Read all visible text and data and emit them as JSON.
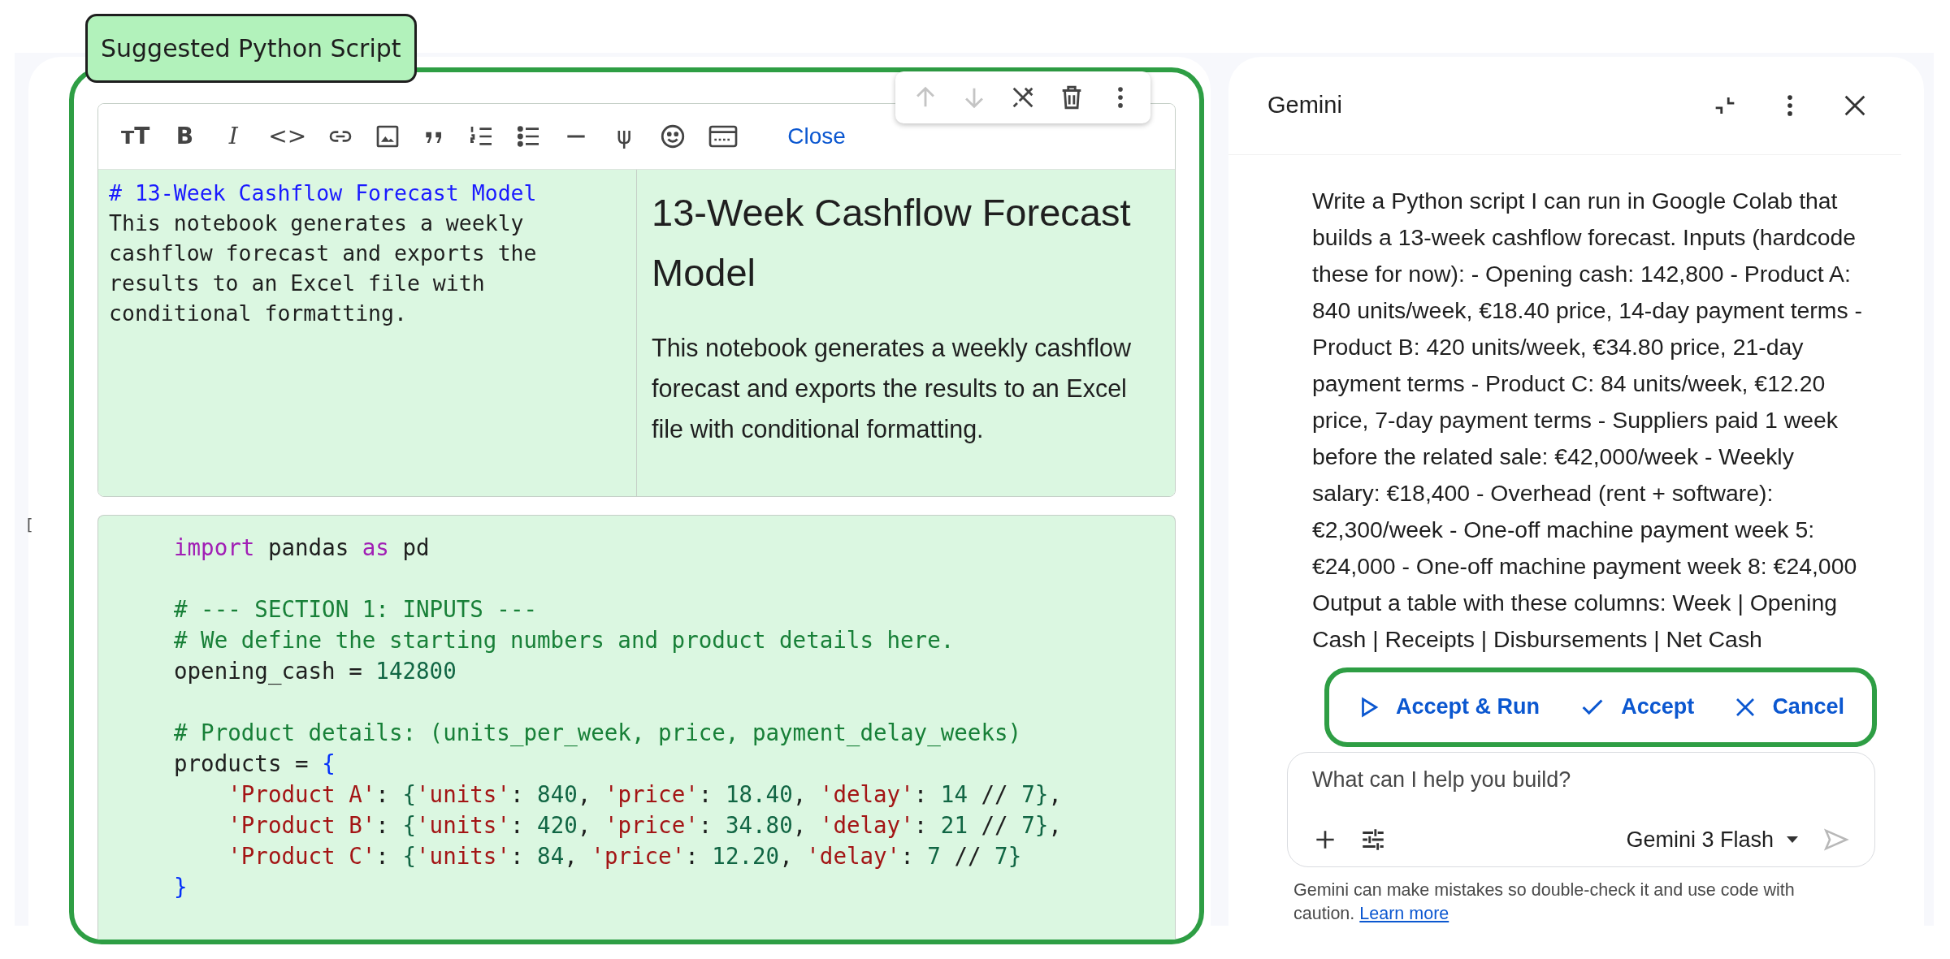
{
  "annotation_label": "Suggested Python Script",
  "cell_toolbar": [
    {
      "kind": "up",
      "disabled": true
    },
    {
      "kind": "down",
      "disabled": true
    },
    {
      "kind": "unlink",
      "disabled": false
    },
    {
      "kind": "delete",
      "disabled": false
    },
    {
      "kind": "more",
      "disabled": false
    }
  ],
  "markdown_toolbar": {
    "items": [
      {
        "kind": "text-size",
        "glyph": "ᴛT"
      },
      {
        "kind": "bold",
        "glyph": "B"
      },
      {
        "kind": "italic",
        "glyph": "I"
      },
      {
        "kind": "code",
        "glyph": "<>"
      },
      {
        "kind": "link"
      },
      {
        "kind": "image"
      },
      {
        "kind": "quote"
      },
      {
        "kind": "numbered-list"
      },
      {
        "kind": "bulleted-list"
      },
      {
        "kind": "rule"
      },
      {
        "kind": "psi",
        "glyph": "ψ"
      },
      {
        "kind": "smiley"
      },
      {
        "kind": "window"
      }
    ],
    "close": "Close"
  },
  "markdown_cell": {
    "source_heading": "# 13-Week Cashflow Forecast Model",
    "source_body": "This notebook generates a weekly cashflow forecast and exports the results to an Excel file with conditional formatting.",
    "rendered_heading": "13-Week Cashflow Forecast Model",
    "rendered_body": "This notebook generates a weekly cashflow forecast and exports the results to an Excel file with conditional formatting."
  },
  "code_cell": {
    "run_bracket": "[",
    "blocks": [
      [
        [
          {
            "t": "import",
            "kind": "keyword"
          },
          {
            "t": " pandas ",
            "kind": "plain"
          },
          {
            "t": "as",
            "kind": "keyword"
          },
          {
            "t": " pd",
            "kind": "plain"
          }
        ]
      ],
      [
        [
          {
            "t": "# --- SECTION 1: INPUTS ---",
            "kind": "comment"
          }
        ],
        [
          {
            "t": "# We define the starting numbers and product details here.",
            "kind": "comment"
          }
        ],
        [
          {
            "t": "opening_cash = ",
            "kind": "plain"
          },
          {
            "t": "142800",
            "kind": "number"
          }
        ]
      ],
      [
        [
          {
            "t": "# Product details: (units_per_week, price, payment_delay_weeks)",
            "kind": "comment"
          }
        ],
        [
          {
            "t": "products = ",
            "kind": "plain"
          },
          {
            "t": "{",
            "kind": "brace"
          }
        ],
        [
          {
            "t": "    'Product A'",
            "kind": "string"
          },
          {
            "t": ": ",
            "kind": "plain"
          },
          {
            "t": "{",
            "kind": "brace2"
          },
          {
            "t": "'units'",
            "kind": "string"
          },
          {
            "t": ": ",
            "kind": "plain"
          },
          {
            "t": "840",
            "kind": "number"
          },
          {
            "t": ", ",
            "kind": "plain"
          },
          {
            "t": "'price'",
            "kind": "string"
          },
          {
            "t": ": ",
            "kind": "plain"
          },
          {
            "t": "18.40",
            "kind": "number"
          },
          {
            "t": ", ",
            "kind": "plain"
          },
          {
            "t": "'delay'",
            "kind": "string"
          },
          {
            "t": ": ",
            "kind": "plain"
          },
          {
            "t": "14",
            "kind": "number"
          },
          {
            "t": " // ",
            "kind": "plain"
          },
          {
            "t": "7",
            "kind": "number"
          },
          {
            "t": "}",
            "kind": "brace2"
          },
          {
            "t": ",",
            "kind": "plain"
          }
        ],
        [
          {
            "t": "    'Product B'",
            "kind": "string"
          },
          {
            "t": ": ",
            "kind": "plain"
          },
          {
            "t": "{",
            "kind": "brace2"
          },
          {
            "t": "'units'",
            "kind": "string"
          },
          {
            "t": ": ",
            "kind": "plain"
          },
          {
            "t": "420",
            "kind": "number"
          },
          {
            "t": ", ",
            "kind": "plain"
          },
          {
            "t": "'price'",
            "kind": "string"
          },
          {
            "t": ": ",
            "kind": "plain"
          },
          {
            "t": "34.80",
            "kind": "number"
          },
          {
            "t": ", ",
            "kind": "plain"
          },
          {
            "t": "'delay'",
            "kind": "string"
          },
          {
            "t": ": ",
            "kind": "plain"
          },
          {
            "t": "21",
            "kind": "number"
          },
          {
            "t": " // ",
            "kind": "plain"
          },
          {
            "t": "7",
            "kind": "number"
          },
          {
            "t": "}",
            "kind": "brace2"
          },
          {
            "t": ",",
            "kind": "plain"
          }
        ],
        [
          {
            "t": "    'Product C'",
            "kind": "string"
          },
          {
            "t": ": ",
            "kind": "plain"
          },
          {
            "t": "{",
            "kind": "brace2"
          },
          {
            "t": "'units'",
            "kind": "string"
          },
          {
            "t": ": ",
            "kind": "plain"
          },
          {
            "t": "84",
            "kind": "number"
          },
          {
            "t": ", ",
            "kind": "plain"
          },
          {
            "t": "'price'",
            "kind": "string"
          },
          {
            "t": ": ",
            "kind": "plain"
          },
          {
            "t": "12.20",
            "kind": "number"
          },
          {
            "t": ", ",
            "kind": "plain"
          },
          {
            "t": "'delay'",
            "kind": "string"
          },
          {
            "t": ": ",
            "kind": "plain"
          },
          {
            "t": "7",
            "kind": "number"
          },
          {
            "t": " // ",
            "kind": "plain"
          },
          {
            "t": "7",
            "kind": "number"
          },
          {
            "t": "}",
            "kind": "brace2"
          }
        ],
        [
          {
            "t": "}",
            "kind": "brace"
          }
        ]
      ]
    ]
  },
  "gemini": {
    "title": "Gemini",
    "prompt": "Write a Python script I can run in Google Colab that builds a 13-week cashflow forecast. Inputs (hardcode these for now): - Opening cash: 142,800 - Product A: 840 units/week, €18.40 price, 14-day payment terms - Product B: 420 units/week, €34.80 price, 21-day payment terms - Product C: 84 units/week, €12.20 price, 7-day payment terms - Suppliers paid 1 week before the related sale: €42,000/week - Weekly salary: €18,400 - Overhead (rent + software): €2,300/week - One-off machine payment week 5: €24,000 - One-off machine payment week 8: €24,000 Output a table with these columns: Week | Opening Cash | Receipts | Disbursements | Net Cash",
    "actions": [
      {
        "kind": "run",
        "label": "Accept & Run"
      },
      {
        "kind": "accept",
        "label": "Accept"
      },
      {
        "kind": "cancel",
        "label": "Cancel"
      }
    ],
    "input": {
      "placeholder": "What can I help you build?"
    },
    "model": "Gemini 3 Flash",
    "send_disabled": true,
    "disclaimer": "Gemini can make mistakes so double-check it and use code with caution.",
    "learn_more": "Learn more"
  }
}
